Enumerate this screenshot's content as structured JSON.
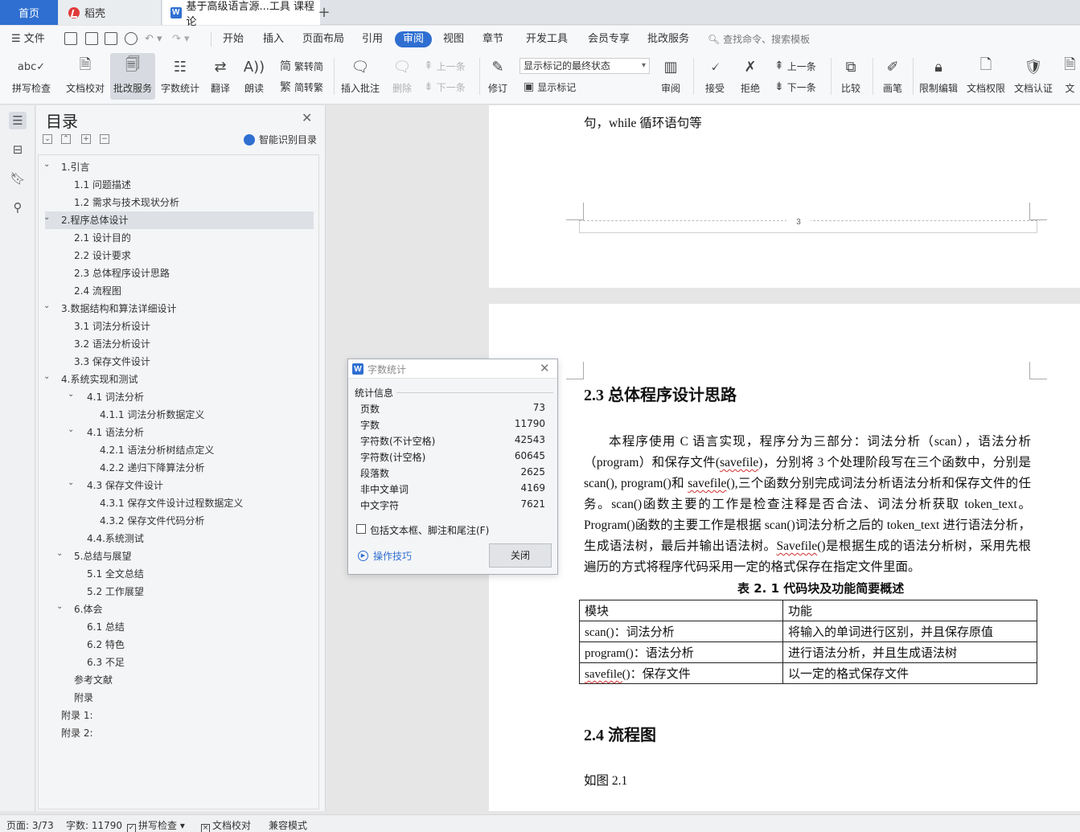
{
  "tabs": {
    "home": "首页",
    "docer": "稻壳",
    "document": "基于高级语言源...工具 课程论",
    "wps_logo_letter": "W"
  },
  "menu": {
    "file": "文件",
    "items": [
      "开始",
      "插入",
      "页面布局",
      "引用",
      "审阅",
      "视图",
      "章节",
      "开发工具",
      "会员专享",
      "批改服务"
    ],
    "active": "审阅",
    "search_placeholder": "查找命令、搜索模板"
  },
  "ribbon": {
    "spellcheck": "拼写检查",
    "proofread": "文档校对",
    "correction_service": "批改服务",
    "word_count": "字数统计",
    "translate": "翻译",
    "read_aloud": "朗读",
    "trad_to_simp_1": "繁转简",
    "simp_to_trad": "简转繁",
    "insert_comment": "插入批注",
    "delete": "删除",
    "prev": "上一条",
    "next": "下一条",
    "track_changes": "修订",
    "markup_state": "显示标记的最终状态",
    "show_markup": "显示标记",
    "review": "审阅",
    "accept": "接受",
    "reject": "拒绝",
    "prev2": "上一条",
    "next2": "下一条",
    "compare": "比较",
    "pen": "画笔",
    "restrict_edit": "限制编辑",
    "doc_permission": "文档权限",
    "doc_cert": "文档认证",
    "doc_more": "文"
  },
  "toc": {
    "title": "目录",
    "smart": "智能识别目录",
    "items": [
      {
        "label": "1.引言",
        "level": 1,
        "expanded": true
      },
      {
        "label": "1.1 问题描述",
        "level": 2
      },
      {
        "label": "1.2 需求与技术现状分析",
        "level": 2
      },
      {
        "label": "2.程序总体设计",
        "level": 1,
        "expanded": true,
        "selected": true
      },
      {
        "label": "2.1 设计目的",
        "level": 2
      },
      {
        "label": "2.2 设计要求",
        "level": 2
      },
      {
        "label": "2.3 总体程序设计思路",
        "level": 2
      },
      {
        "label": "2.4 流程图",
        "level": 2
      },
      {
        "label": "3.数据结构和算法详细设计",
        "level": 1,
        "expanded": true
      },
      {
        "label": "3.1 词法分析设计",
        "level": 2
      },
      {
        "label": "3.2 语法分析设计",
        "level": 2
      },
      {
        "label": "3.3 保存文件设计",
        "level": 2
      },
      {
        "label": "4.系统实现和测试",
        "level": 1,
        "expanded": true
      },
      {
        "label": "4.1 词法分析",
        "level": 3,
        "expanded": true
      },
      {
        "label": "4.1.1 词法分析数据定义",
        "level": 4
      },
      {
        "label": "4.1 语法分析",
        "level": 3,
        "expanded": true
      },
      {
        "label": "4.2.1 语法分析树结点定义",
        "level": 4
      },
      {
        "label": "4.2.2 递归下降算法分析",
        "level": 4
      },
      {
        "label": "4.3 保存文件设计",
        "level": 3,
        "expanded": true
      },
      {
        "label": "4.3.1 保存文件设计过程数据定义",
        "level": 4
      },
      {
        "label": "4.3.2 保存文件代码分析",
        "level": 4
      },
      {
        "label": "4.4.系统测试",
        "level": 3
      },
      {
        "label": "5.总结与展望",
        "level": 5,
        "expanded": true
      },
      {
        "label": "5.1 全文总结",
        "level": 3
      },
      {
        "label": "5.2 工作展望",
        "level": 3
      },
      {
        "label": "6.体会",
        "level": 5,
        "expanded": true
      },
      {
        "label": "6.1 总结",
        "level": 3
      },
      {
        "label": "6.2 特色",
        "level": 3
      },
      {
        "label": "6.3 不足",
        "level": 3
      },
      {
        "label": "参考文献",
        "level": 2
      },
      {
        "label": "附录",
        "level": 2
      },
      {
        "label": "附录 1:",
        "level": 1,
        "leaf": true
      },
      {
        "label": "附录 2:",
        "level": 1,
        "leaf": true
      }
    ]
  },
  "document": {
    "page1_tail": "句，while 循环语句等",
    "page_number": "3",
    "heading_23": "2.3 总体程序设计思路",
    "body_segments": [
      {
        "t": "本程序使用 C 语言实现，程序分为三部分：词法分析（scan），语法分析（program）和保存文件(",
        "w": false
      },
      {
        "t": "savefile",
        "w": true
      },
      {
        "t": ")，分别将 3 个处理阶段写在三个函数中，分别是 scan(), program()和 ",
        "w": false
      },
      {
        "t": "savefile",
        "w": true
      },
      {
        "t": "(),三个函数分别完成词法分析语法分析和保存文件的任务。scan()函数主要的工作是检查注释是否合法、词法分析获取 token_text。Program()函数的主要工作是根据 scan()词法分析之后的 token_text 进行语法分析，生成语法树，最后并输出语法树。",
        "w": false
      },
      {
        "t": "Savefile",
        "w": true
      },
      {
        "t": "()是根据生成的语法分析树，采用先根遍历的方式将程序代码采用一定的格式保存在指定文件里面。",
        "w": false
      }
    ],
    "table_caption": "表 2. 1 代码块及功能简要概述",
    "table": {
      "header": [
        "模块",
        "功能"
      ],
      "rows": [
        {
          "module": "scan()：词法分析",
          "func": "将输入的单词进行区别，并且保存原值"
        },
        {
          "module": "program()：语法分析",
          "func": "进行语法分析，并且生成语法树"
        },
        {
          "module_word": "savefile",
          "module_rest": "()：保存文件",
          "func": "以一定的格式保存文件"
        }
      ]
    },
    "heading_24": "2.4 流程图",
    "figure_ref": "如图 2.1"
  },
  "dialog": {
    "title": "字数统计",
    "section": "统计信息",
    "stats": [
      {
        "label": "页数",
        "value": "73"
      },
      {
        "label": "字数",
        "value": "11790"
      },
      {
        "label": "字符数(不计空格)",
        "value": "42543"
      },
      {
        "label": "字符数(计空格)",
        "value": "60645"
      },
      {
        "label": "段落数",
        "value": "2625"
      },
      {
        "label": "非中文单词",
        "value": "4169"
      },
      {
        "label": "中文字符",
        "value": "7621"
      }
    ],
    "include_label": "包括文本框、脚注和尾注(F)",
    "include_checked": false,
    "tips": "操作技巧",
    "close_button": "关闭"
  },
  "status": {
    "page": "页面: 3/73",
    "words": "字数: 11790",
    "spellcheck": "拼写检查",
    "proofread": "文档校对",
    "compat": "兼容模式"
  },
  "colors": {
    "accent": "#2f6fd1",
    "spell_error": "#d03030"
  }
}
